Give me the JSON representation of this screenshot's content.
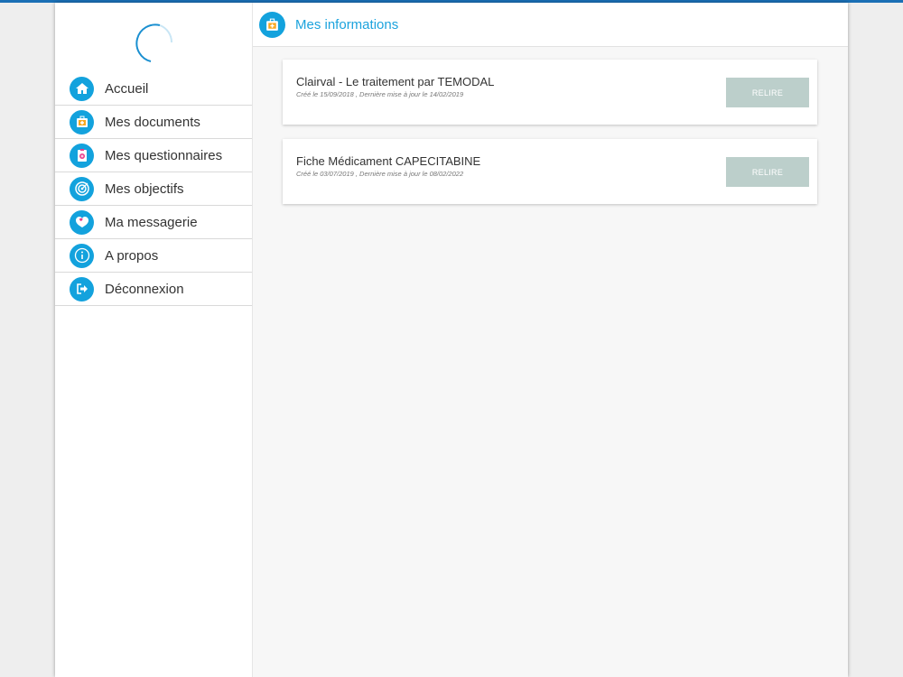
{
  "sidebar": {
    "items": [
      {
        "label": "Accueil",
        "icon": "home-icon"
      },
      {
        "label": "Mes documents",
        "icon": "medical-kit-icon"
      },
      {
        "label": "Mes questionnaires",
        "icon": "clipboard-icon"
      },
      {
        "label": "Mes objectifs",
        "icon": "target-icon"
      },
      {
        "label": "Ma messagerie",
        "icon": "message-heart-icon"
      },
      {
        "label": "A propos",
        "icon": "info-icon"
      },
      {
        "label": "Déconnexion",
        "icon": "logout-icon"
      }
    ]
  },
  "header": {
    "title": "Mes informations",
    "icon": "medical-kit-icon"
  },
  "documents": [
    {
      "title": "Clairval - Le traitement par TEMODAL",
      "meta": "Créé le 15/09/2018 , Dernière mise à jour le 14/02/2019",
      "button": "RELIRE"
    },
    {
      "title": "Fiche Médicament CAPECITABINE",
      "meta": "Créé le 03/07/2019 , Dernière mise à jour le 08/02/2022",
      "button": "RELIRE"
    }
  ],
  "colors": {
    "accent": "#13a2dd",
    "topbar": "#1a6fb5",
    "button": "#bccfcb"
  }
}
